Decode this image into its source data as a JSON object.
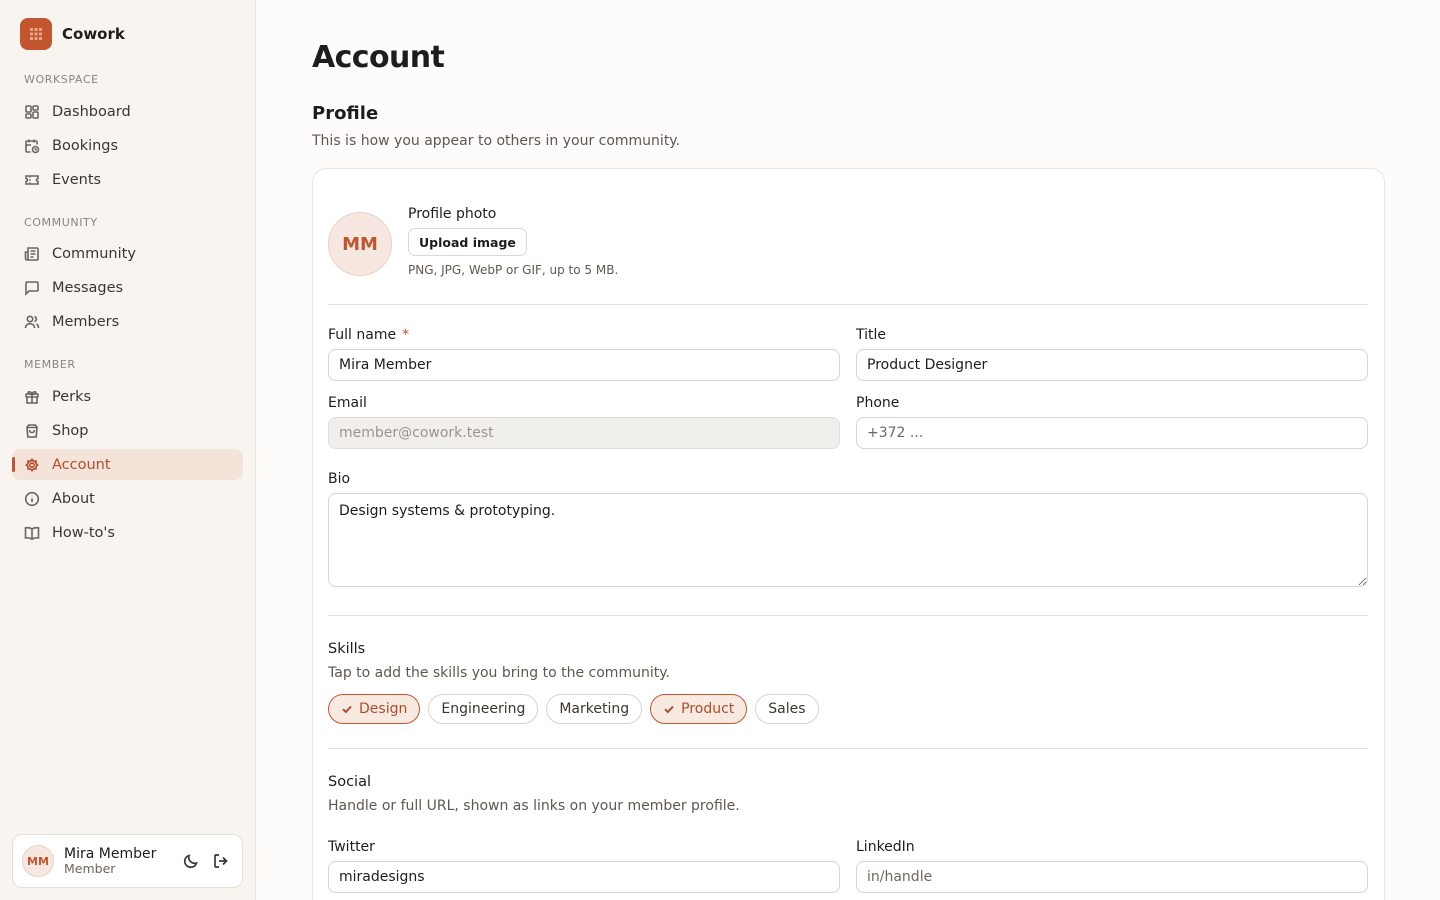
{
  "app": {
    "name": "Cowork",
    "logo_icon": "grid-logo-icon",
    "accent": "#c4562f"
  },
  "sidebar": {
    "sections": [
      {
        "label": "WORKSPACE",
        "items": [
          {
            "label": "Dashboard",
            "icon": "dashboard-icon"
          },
          {
            "label": "Bookings",
            "icon": "calendar-clock-icon"
          },
          {
            "label": "Events",
            "icon": "ticket-icon"
          }
        ]
      },
      {
        "label": "COMMUNITY",
        "items": [
          {
            "label": "Community",
            "icon": "newspaper-icon"
          },
          {
            "label": "Messages",
            "icon": "message-icon"
          },
          {
            "label": "Members",
            "icon": "users-icon"
          }
        ]
      },
      {
        "label": "MEMBER",
        "items": [
          {
            "label": "Perks",
            "icon": "gift-icon"
          },
          {
            "label": "Shop",
            "icon": "shopping-bag-icon"
          },
          {
            "label": "Account",
            "icon": "settings-icon",
            "active": true
          },
          {
            "label": "About",
            "icon": "info-icon"
          },
          {
            "label": "How-to's",
            "icon": "book-icon"
          }
        ]
      }
    ],
    "user": {
      "initials": "MM",
      "name": "Mira Member",
      "role": "Member"
    }
  },
  "page": {
    "title": "Account",
    "profile": {
      "title": "Profile",
      "subtitle": "This is how you appear to others in your community.",
      "avatar_initials": "MM",
      "photo_label": "Profile photo",
      "upload_label": "Upload image",
      "photo_hint": "PNG, JPG, WebP or GIF, up to 5 MB."
    },
    "fields": {
      "full_name": {
        "label": "Full name",
        "required_mark": "*",
        "value": "Mira Member"
      },
      "title": {
        "label": "Title",
        "value": "Product Designer"
      },
      "email": {
        "label": "Email",
        "value": "member@cowork.test"
      },
      "phone": {
        "label": "Phone",
        "placeholder": "+372 ..."
      },
      "bio": {
        "label": "Bio",
        "value": "Design systems & prototyping."
      }
    },
    "skills": {
      "title": "Skills",
      "subtitle": "Tap to add the skills you bring to the community.",
      "chips": [
        {
          "label": "Design",
          "selected": true
        },
        {
          "label": "Engineering",
          "selected": false
        },
        {
          "label": "Marketing",
          "selected": false
        },
        {
          "label": "Product",
          "selected": true
        },
        {
          "label": "Sales",
          "selected": false
        }
      ]
    },
    "social": {
      "title": "Social",
      "subtitle": "Handle or full URL, shown as links on your member profile.",
      "twitter": {
        "label": "Twitter",
        "value": "miradesigns"
      },
      "linkedin": {
        "label": "LinkedIn",
        "placeholder": "in/handle"
      }
    }
  }
}
